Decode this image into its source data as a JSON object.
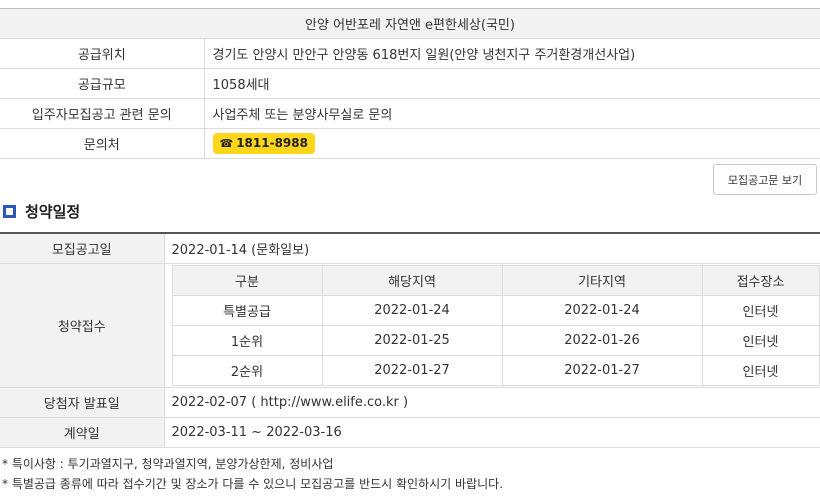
{
  "info": {
    "title": "안양 어반포레 자연앤 e편한세상(국민)",
    "rows": [
      {
        "label": "공급위치",
        "value": "경기도 안양시 만안구 안양동 618번지 일원(안양 냉천지구 주거환경개선사업)"
      },
      {
        "label": "공급규모",
        "value": "1058세대"
      },
      {
        "label": "입주자모집공고 관련 문의",
        "value": "사업주체 또는 분양사무실로 문의"
      }
    ],
    "contact": {
      "label": "문의처",
      "phone_icon": "☎",
      "phone": "1811-8988"
    }
  },
  "notice_button": "모집공고문 보기",
  "schedule": {
    "title": "청약일정",
    "announce": {
      "label": "모집공고일",
      "value": "2022-01-14 (문화일보)"
    },
    "apply": {
      "label": "청약접수",
      "headers": [
        "구분",
        "해당지역",
        "기타지역",
        "접수장소"
      ],
      "rows": [
        [
          "특별공급",
          "2022-01-24",
          "2022-01-24",
          "인터넷"
        ],
        [
          "1순위",
          "2022-01-25",
          "2022-01-26",
          "인터넷"
        ],
        [
          "2순위",
          "2022-01-27",
          "2022-01-27",
          "인터넷"
        ]
      ]
    },
    "winner": {
      "label": "당첨자 발표일",
      "date": "2022-02-07",
      "open": " ( ",
      "link": "http://www.elife.co.kr",
      "close": " )"
    },
    "contract": {
      "label": "계약일",
      "value": "2022-03-11 ~ 2022-03-16"
    }
  },
  "notes": [
    "* 특이사항 : 투기과열지구, 청약과열지역, 분양가상한제, 정비사업",
    "* 특별공급 종류에 따라 접수기간 및 장소가 다를 수 있으니 모집공고를 반드시 확인하시기 바랍니다."
  ]
}
